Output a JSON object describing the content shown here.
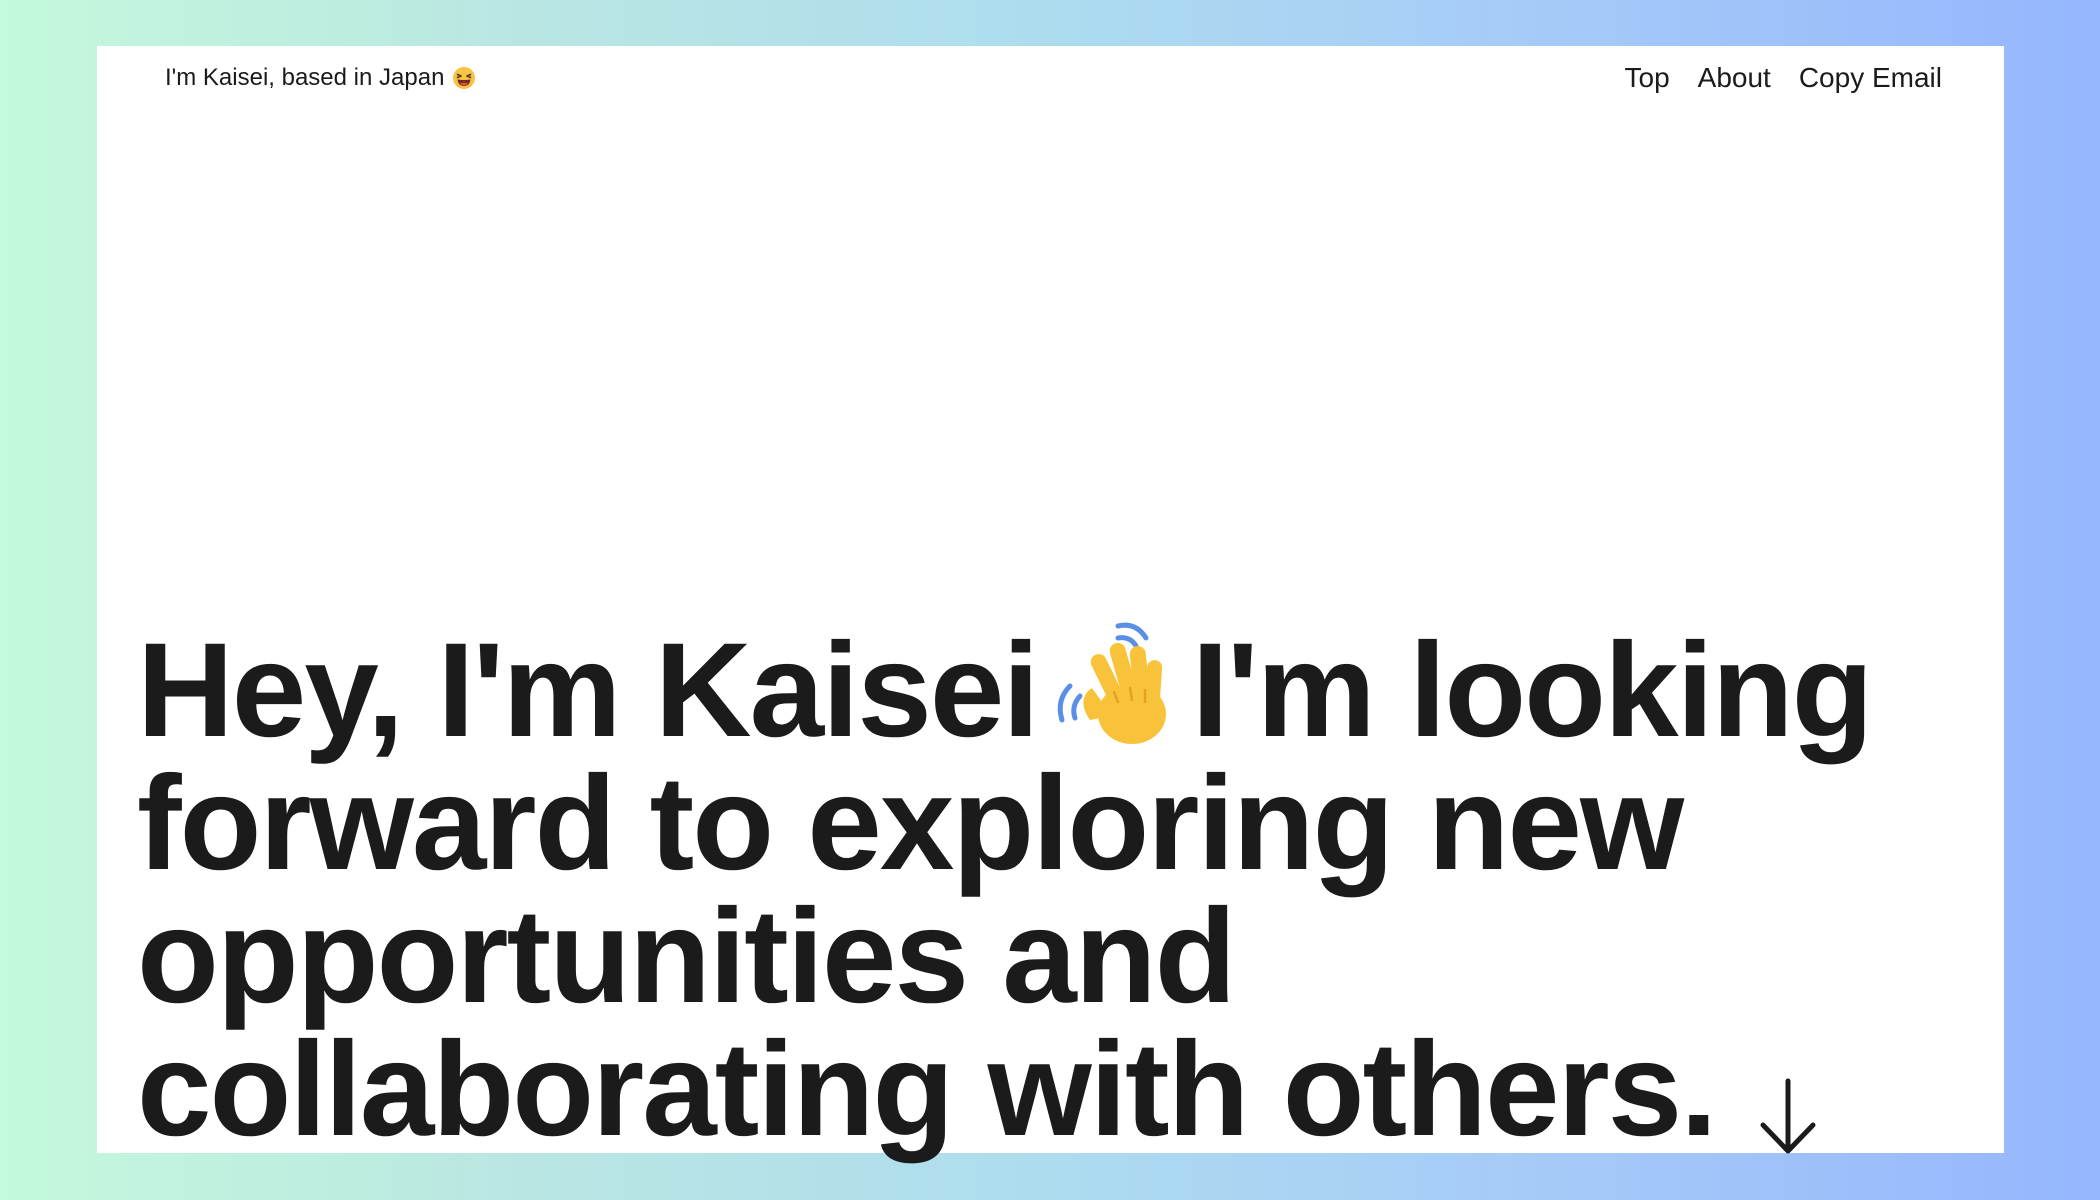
{
  "header": {
    "tagline": "I'm Kaisei, based in Japan",
    "tagline_icon": "grinning-squinting-face-icon",
    "nav": [
      {
        "label": "Top"
      },
      {
        "label": "About"
      },
      {
        "label": "Copy Email"
      }
    ]
  },
  "hero": {
    "line1_part1": "Hey, I'm Kaisei",
    "line1_icon": "waving-hand-icon",
    "line1_part2": "I'm looking",
    "line2": "forward to exploring new",
    "line3": "opportunities and",
    "line4": "collaborating with others.",
    "scroll_icon": "arrow-down-icon"
  },
  "colors": {
    "background_gradient_start": "#c3f9dc",
    "background_gradient_end": "#95b6fd",
    "frame": "#ffffff",
    "text": "#1b1b1b"
  }
}
